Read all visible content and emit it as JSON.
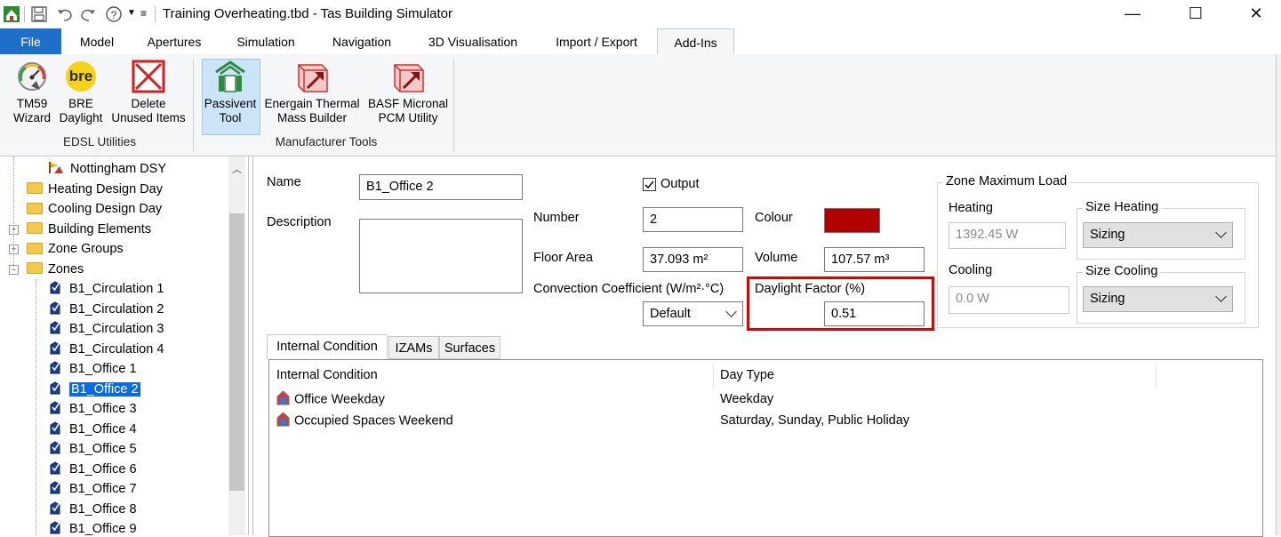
{
  "window": {
    "title": "Training Overheating.tbd - Tas Building Simulator",
    "minimize": "—",
    "maximize": "☐",
    "close": "✕"
  },
  "ribbon_tabs": [
    "File",
    "Model",
    "Apertures",
    "Simulation",
    "Navigation",
    "3D Visualisation",
    "Import / Export",
    "Add-Ins"
  ],
  "ribbon": {
    "edsl_buttons": [
      {
        "line1": "TM59",
        "line2": "Wizard"
      },
      {
        "line1": "BRE",
        "line2": "Daylight"
      },
      {
        "line1": "Delete",
        "line2": "Unused Items"
      }
    ],
    "edsl_group": "EDSL Utilities",
    "manufacturer_buttons": [
      {
        "line1": "Passivent",
        "line2": "Tool"
      },
      {
        "line1": "Energain Thermal",
        "line2": "Mass Builder"
      },
      {
        "line1": "BASF Micronal",
        "line2": "PCM Utility"
      }
    ],
    "manufacturer_group": "Manufacturer Tools",
    "bre_logo_text": "bre"
  },
  "tree": {
    "items": [
      {
        "label": "Nottingham DSY",
        "type": "weather"
      },
      {
        "label": "Heating Design Day",
        "type": "folder"
      },
      {
        "label": "Cooling Design Day",
        "type": "folder"
      },
      {
        "label": "Building Elements",
        "type": "folder"
      },
      {
        "label": "Zone Groups",
        "type": "folder"
      },
      {
        "label": "Zones",
        "type": "folder"
      },
      {
        "label": "B1_Circulation 1",
        "type": "zone"
      },
      {
        "label": "B1_Circulation 2",
        "type": "zone"
      },
      {
        "label": "B1_Circulation 3",
        "type": "zone"
      },
      {
        "label": "B1_Circulation 4",
        "type": "zone"
      },
      {
        "label": "B1_Office 1",
        "type": "zone"
      },
      {
        "label": "B1_Office 2",
        "type": "zone"
      },
      {
        "label": "B1_Office 3",
        "type": "zone"
      },
      {
        "label": "B1_Office 4",
        "type": "zone"
      },
      {
        "label": "B1_Office 5",
        "type": "zone"
      },
      {
        "label": "B1_Office 6",
        "type": "zone"
      },
      {
        "label": "B1_Office 7",
        "type": "zone"
      },
      {
        "label": "B1_Office 8",
        "type": "zone"
      },
      {
        "label": "B1_Office 9",
        "type": "zone"
      }
    ]
  },
  "zone": {
    "name_label": "Name",
    "name_value": "B1_Office 2",
    "description_label": "Description",
    "output_label": "Output",
    "number_label": "Number",
    "number_value": "2",
    "colour_label": "Colour",
    "colour_value": "#b00000",
    "floor_area_label": "Floor Area",
    "floor_area_value": "37.093 m²",
    "volume_label": "Volume",
    "volume_value": "107.57 m³",
    "convection_label": "Convection Coefficient (W/m²·°C)",
    "convection_value": "Default",
    "daylight_label": "Daylight Factor (%)",
    "daylight_value": "0.51"
  },
  "zone_max_load": {
    "title": "Zone Maximum Load",
    "heating_label": "Heating",
    "heating_value": "1392.45 W",
    "size_heating_label": "Size Heating",
    "size_heating_value": "Sizing",
    "cooling_label": "Cooling",
    "cooling_value": "0.0 W",
    "size_cooling_label": "Size Cooling",
    "size_cooling_value": "Sizing"
  },
  "panel_tabs": [
    "Internal Condition",
    "IZAMs",
    "Surfaces"
  ],
  "ic_table": {
    "headers": [
      "Internal Condition",
      "Day Type"
    ],
    "rows": [
      {
        "name": "Office Weekday",
        "day": "Weekday"
      },
      {
        "name": "Occupied Spaces Weekend",
        "day": "Saturday, Sunday, Public Holiday"
      }
    ]
  },
  "colors": {
    "file_tab": "#1e6fc7",
    "selection": "#0b6cd7",
    "highlight_box": "#e00000"
  }
}
